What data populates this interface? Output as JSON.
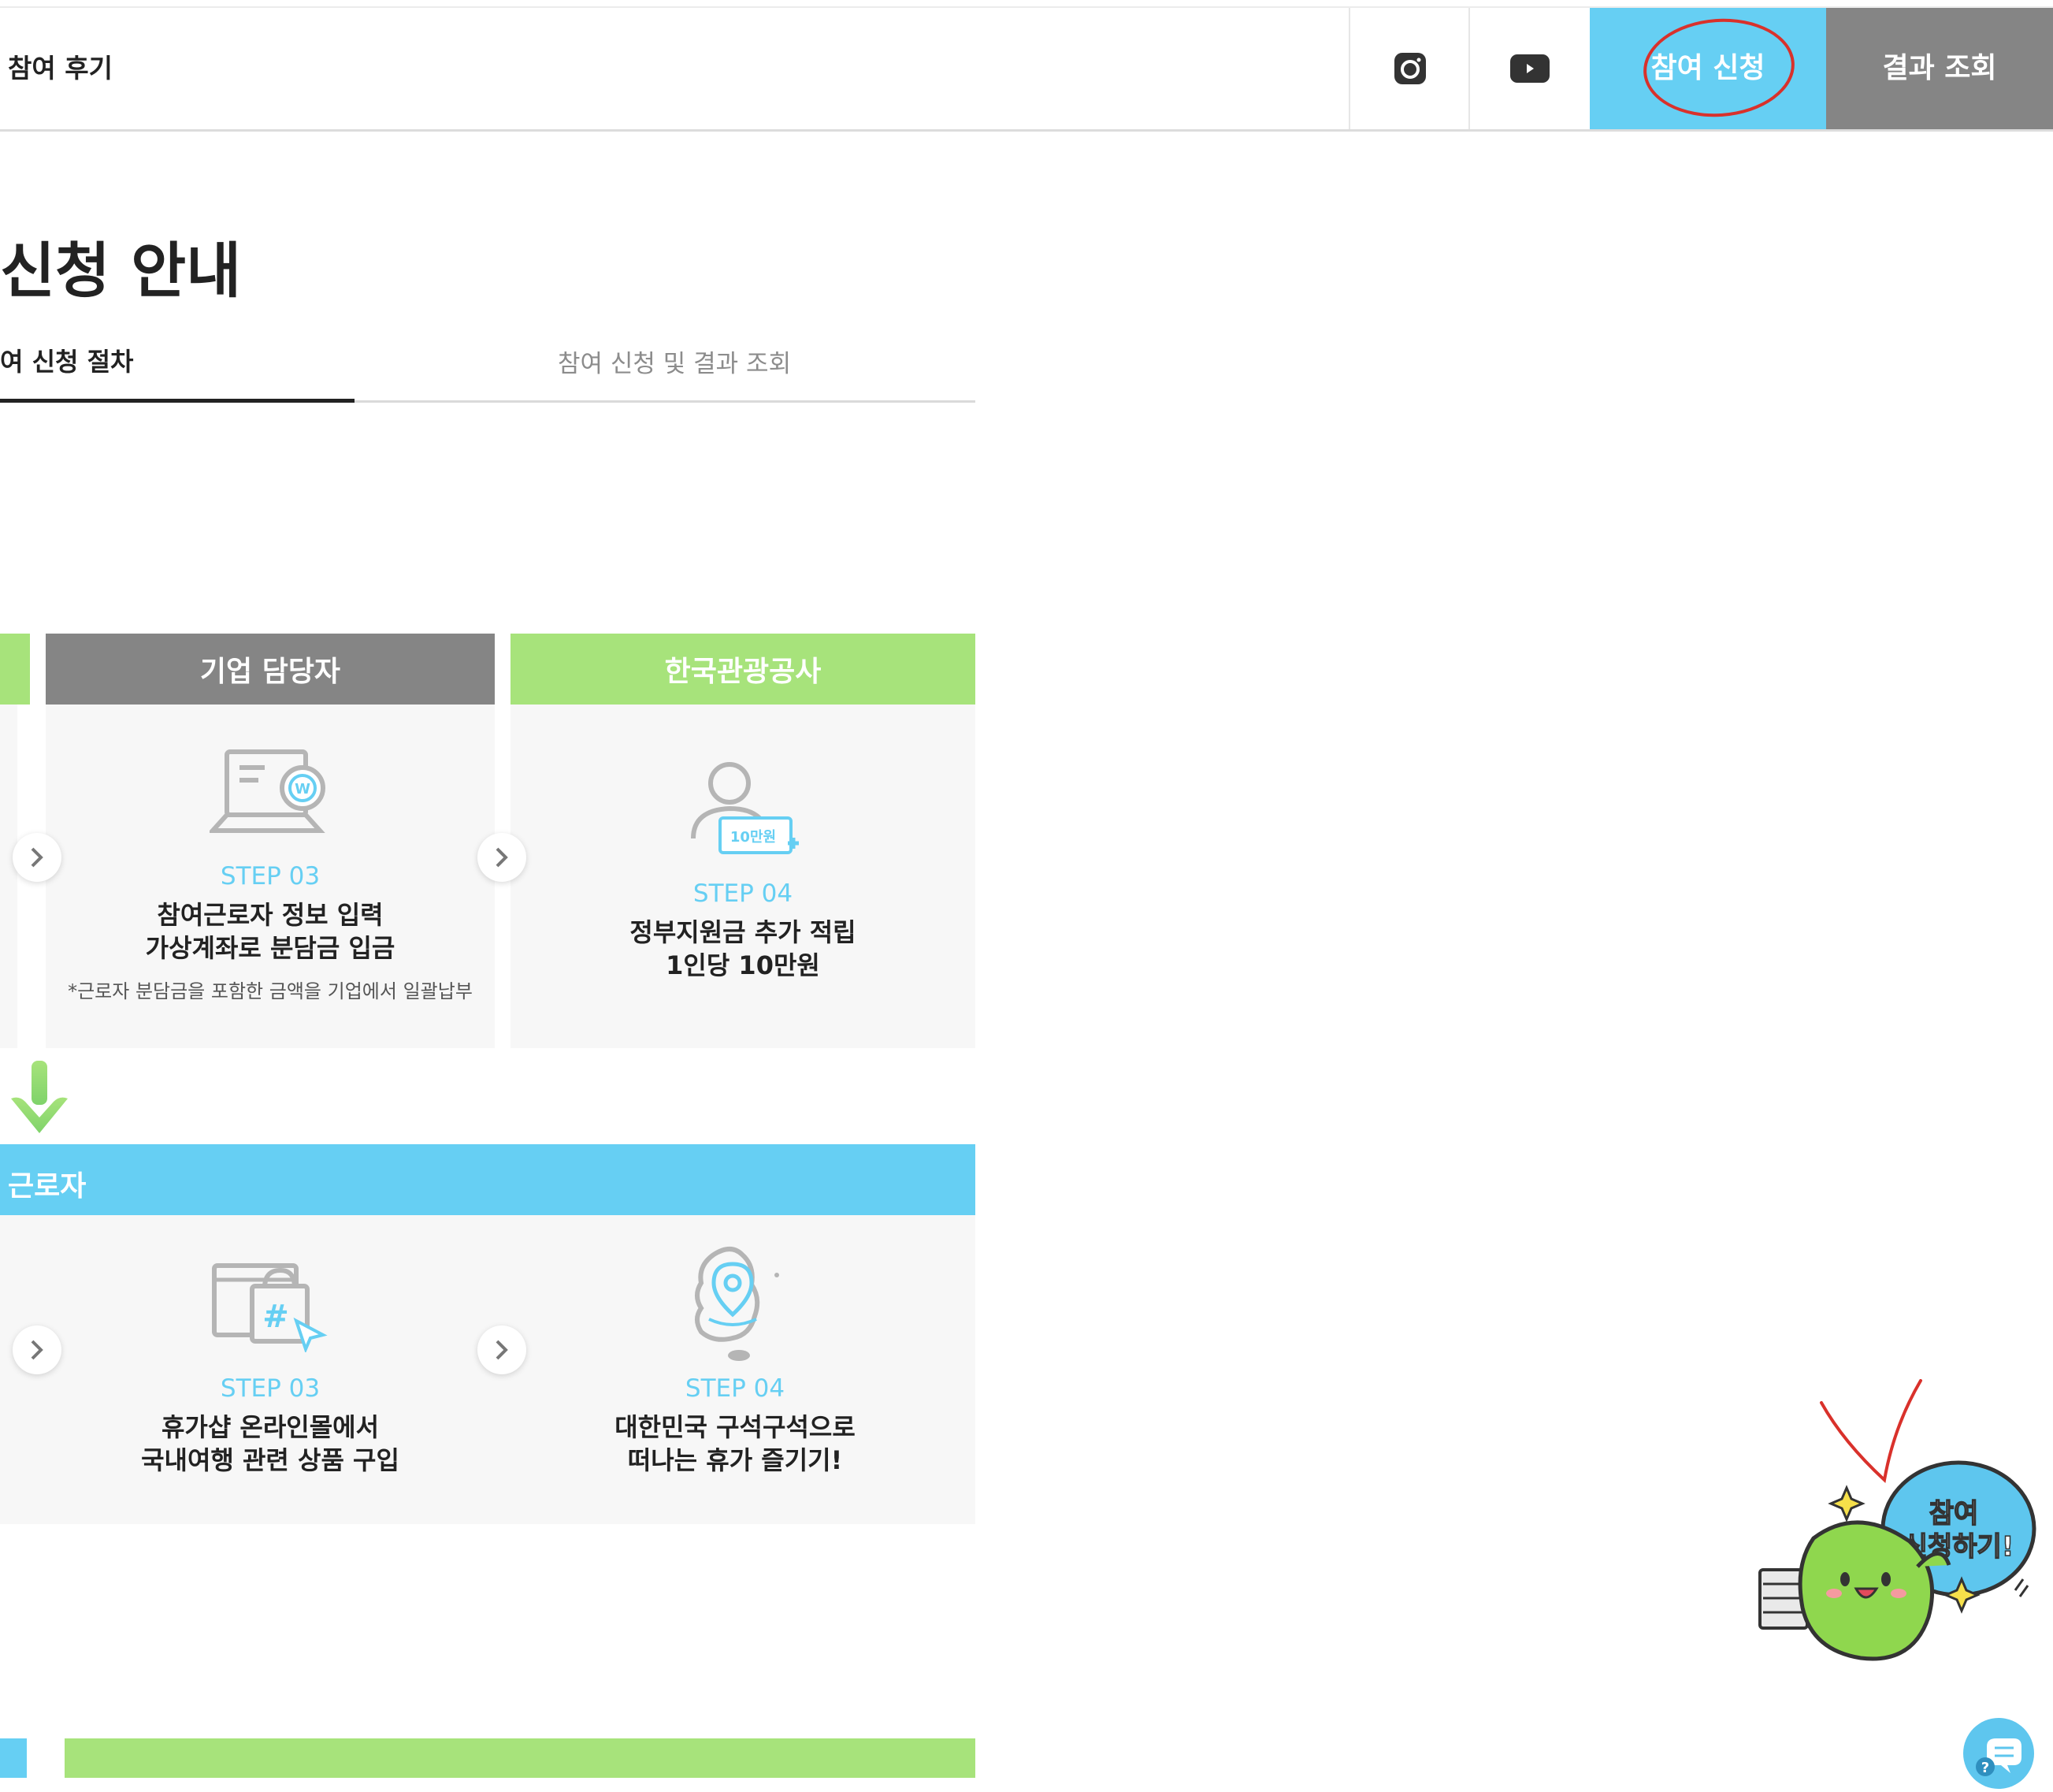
{
  "header": {
    "menu_item": "참여 후기",
    "apply_label": "참여 신청",
    "result_label": "결과 조회"
  },
  "page": {
    "title": "신청 안내",
    "tabs": [
      {
        "label": "여 신청 절차"
      },
      {
        "label": "참여 신청 및 결과 조회"
      }
    ]
  },
  "process": {
    "company_header": "기업 담당자",
    "kto_header": "한국관광공사",
    "worker_header": "근로자",
    "company_step": {
      "num": "STEP 03",
      "line1": "참여근로자 정보 입력",
      "line2": "가상계좌로 분담금 입금",
      "note": "*근로자 분담금을 포함한 금액을 기업에서 일괄납부"
    },
    "kto_step": {
      "num": "STEP 04",
      "line1": "정부지원금 추가 적립",
      "line2": "1인당 10만원",
      "badge": "10만원"
    },
    "worker_step3": {
      "num": "STEP 03",
      "line1": "휴가샵 온라인몰에서",
      "line2": "국내여행 관련 상품 구입"
    },
    "worker_step4": {
      "num": "STEP 04",
      "line1": "대한민국 구석구석으로",
      "line2": "떠나는 휴가 즐기기!"
    }
  },
  "mascot": {
    "bubble_line1": "참여",
    "bubble_line2": "신청하기!"
  },
  "colors": {
    "sky": "#66cff3",
    "green": "#a7e37b",
    "gray": "#858585",
    "annotation_red": "#d9312b"
  }
}
